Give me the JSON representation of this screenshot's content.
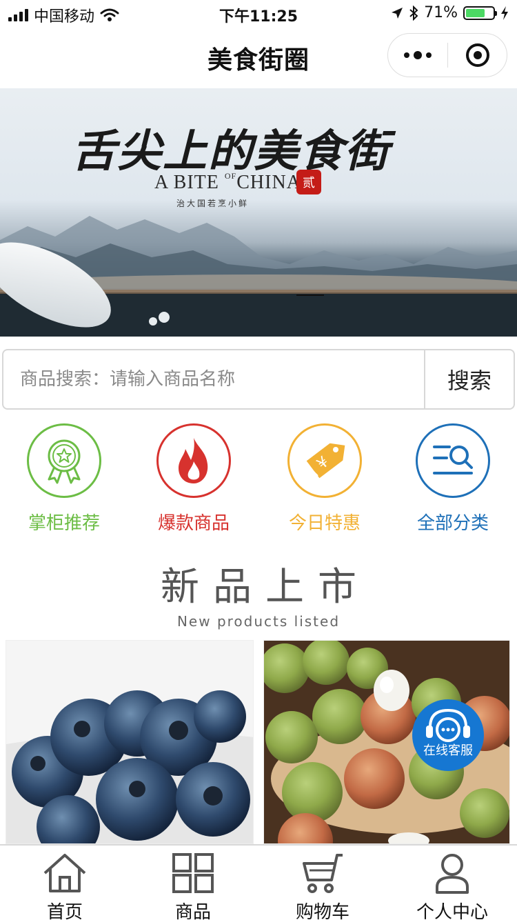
{
  "status_bar": {
    "carrier": "中国移动",
    "time": "下午11:25",
    "battery": "71%",
    "battery_level": 0.71
  },
  "navbar": {
    "title": "美食街圈"
  },
  "banner": {
    "calligraphy": "舌尖上的美食街",
    "english_a": "A BITE",
    "english_of": "OF",
    "english_china": "CHINA",
    "seal": "贰",
    "tagline": "治大国若烹小鲜"
  },
  "search": {
    "placeholder": "商品搜索：请输入商品名称",
    "value": "",
    "button_label": "搜索"
  },
  "categories": [
    {
      "label": "掌柜推荐",
      "color": "#6cbd45",
      "icon": "award-badge-icon"
    },
    {
      "label": "爆款商品",
      "color": "#d7322e",
      "icon": "fire-icon"
    },
    {
      "label": "今日特惠",
      "color": "#f2b134",
      "icon": "price-tag-icon"
    },
    {
      "label": "全部分类",
      "color": "#1e70b8",
      "icon": "search-list-icon"
    }
  ],
  "section": {
    "title": "新品上市",
    "subtitle": "New products listed"
  },
  "products": [
    {
      "name": "blueberries",
      "image": "blueberry-image"
    },
    {
      "name": "lychees",
      "image": "lychee-image"
    }
  ],
  "service": {
    "label": "在线客服",
    "color": "#1677d2"
  },
  "tabbar": {
    "items": [
      {
        "label": "首页",
        "icon": "home-icon"
      },
      {
        "label": "商品",
        "icon": "grid-icon"
      },
      {
        "label": "购物车",
        "icon": "cart-icon"
      },
      {
        "label": "个人中心",
        "icon": "user-icon"
      }
    ]
  }
}
